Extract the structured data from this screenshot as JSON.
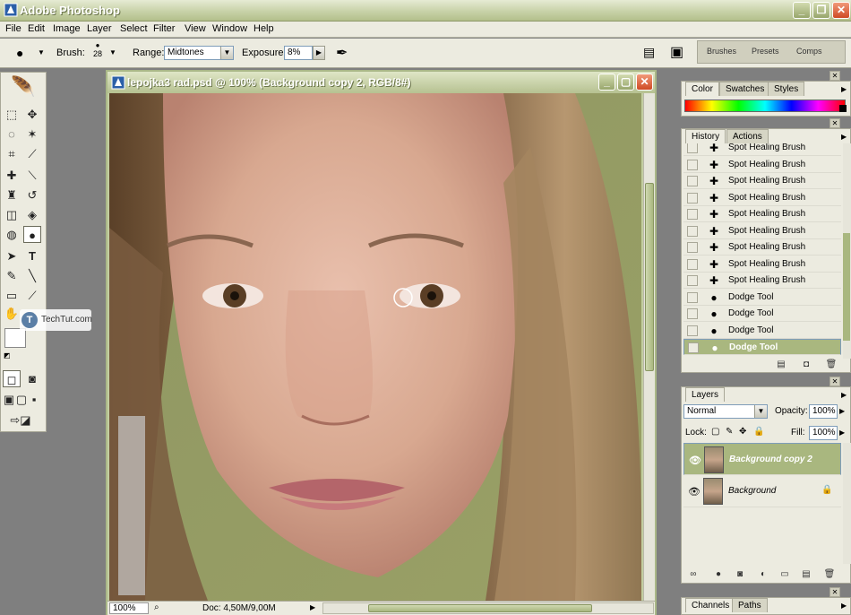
{
  "app": {
    "title": "Adobe Photoshop"
  },
  "menu": [
    "File",
    "Edit",
    "Image",
    "Layer",
    "Select",
    "Filter",
    "View",
    "Window",
    "Help"
  ],
  "options": {
    "brush_label": "Brush:",
    "brush_size": "28",
    "range_label": "Range:",
    "range_value": "Midtones",
    "exposure_label": "Exposure:",
    "exposure_value": "8%"
  },
  "well_tabs": [
    "Brushes",
    "Presets",
    "Comps"
  ],
  "document": {
    "title": "lepojka3 rad.psd @ 100% (Background copy 2, RGB/8#)",
    "zoom": "100%",
    "doc_info": "Doc: 4,50M/9,00M"
  },
  "watermark": "TechTut.com",
  "color_panel": {
    "tabs": [
      "Color",
      "Swatches",
      "Styles"
    ]
  },
  "history_panel": {
    "tabs": [
      "History",
      "Actions"
    ],
    "items": [
      {
        "label": "Spot Healing Brush",
        "icon": "bandage-icon"
      },
      {
        "label": "Spot Healing Brush",
        "icon": "bandage-icon"
      },
      {
        "label": "Spot Healing Brush",
        "icon": "bandage-icon"
      },
      {
        "label": "Spot Healing Brush",
        "icon": "bandage-icon"
      },
      {
        "label": "Spot Healing Brush",
        "icon": "bandage-icon"
      },
      {
        "label": "Spot Healing Brush",
        "icon": "bandage-icon"
      },
      {
        "label": "Spot Healing Brush",
        "icon": "bandage-icon"
      },
      {
        "label": "Spot Healing Brush",
        "icon": "bandage-icon"
      },
      {
        "label": "Spot Healing Brush",
        "icon": "bandage-icon"
      },
      {
        "label": "Dodge Tool",
        "icon": "dodge-icon"
      },
      {
        "label": "Dodge Tool",
        "icon": "dodge-icon"
      },
      {
        "label": "Dodge Tool",
        "icon": "dodge-icon"
      },
      {
        "label": "Dodge Tool",
        "icon": "dodge-icon"
      }
    ],
    "selected_index": 12
  },
  "layers_panel": {
    "tab": "Layers",
    "blend_mode": "Normal",
    "opacity_label": "Opacity:",
    "opacity_value": "100%",
    "lock_label": "Lock:",
    "fill_label": "Fill:",
    "fill_value": "100%",
    "layers": [
      {
        "name": "Background copy 2",
        "selected": true
      },
      {
        "name": "Background",
        "selected": false,
        "locked": true
      }
    ]
  },
  "channels_panel": {
    "tabs": [
      "Channels",
      "Paths"
    ]
  },
  "colors": {
    "accent": "#a9b77f",
    "title": "#b6c191",
    "close": "#cf4a24"
  }
}
